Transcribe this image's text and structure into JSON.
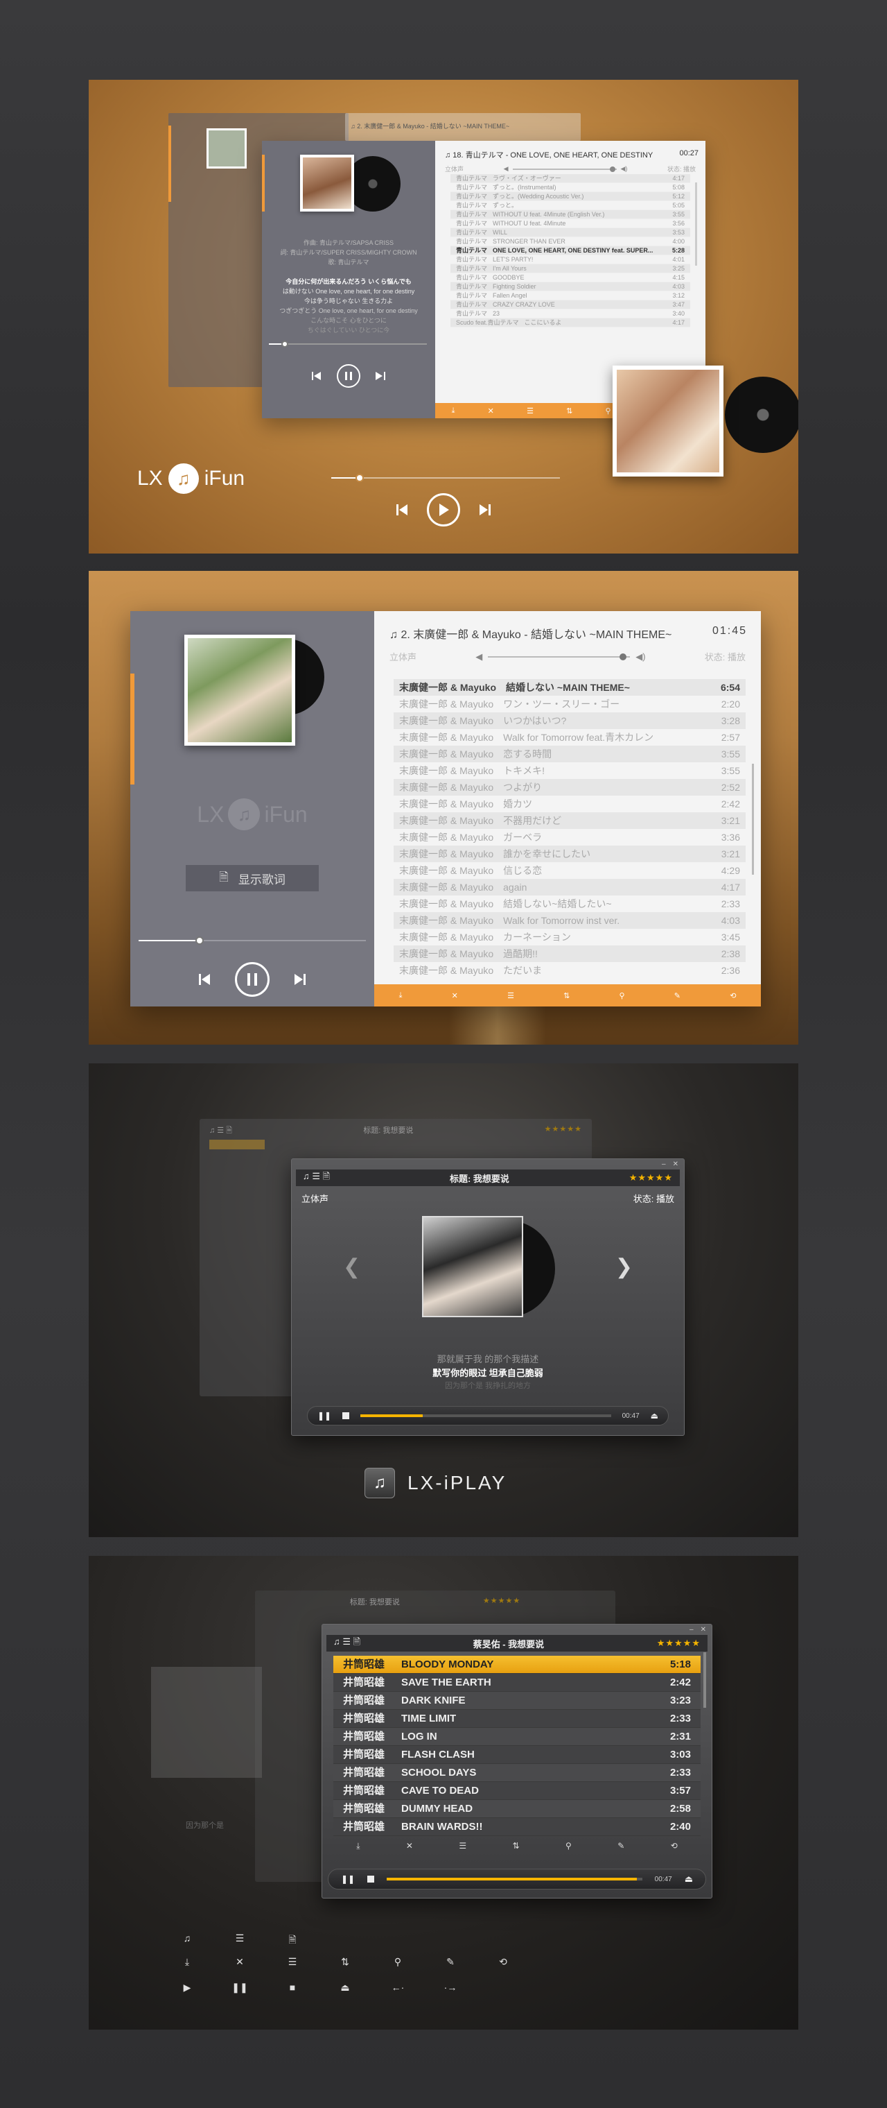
{
  "panel1": {
    "back_title": "♫ 2. 末廣健一郎 & Mayuko - 結婚しない ~MAIN THEME~",
    "now_playing": "♫ 18. 青山テルマ - ONE LOVE, ONE HEART, ONE DESTINY",
    "time": "00:27",
    "stereo": "立体声",
    "status": "状态: 播放",
    "lyrics_meta": [
      "作曲: 青山テルマ/SAPSA CRISS",
      "詞: 青山テルマ/SUPER CRISS/MIGHTY CROWN",
      "歌: 青山テルマ"
    ],
    "lyrics": [
      "今自分に何が出来るんだろう いくら悩んでも",
      "は動けない One love, one heart, for one destiny",
      "今は争う時じゃない 生きる力よ",
      "つぎつぎとう One love, one heart, for one destiny",
      "こんな時こそ 心をひとつに",
      "ちぐはぐしていい ひとつに今"
    ],
    "playlist": [
      {
        "artist": "青山テルマ",
        "title": "ラヴ・イズ・オーヴァー",
        "time": "4:17"
      },
      {
        "artist": "青山テルマ",
        "title": "ずっと。(Instrumental)",
        "time": "5:08"
      },
      {
        "artist": "青山テルマ",
        "title": "ずっと。(Wedding Acoustic Ver.)",
        "time": "5:12"
      },
      {
        "artist": "青山テルマ",
        "title": "ずっと。",
        "time": "5:05"
      },
      {
        "artist": "青山テルマ",
        "title": "WITHOUT U feat. 4Minute (English Ver.)",
        "time": "3:55"
      },
      {
        "artist": "青山テルマ",
        "title": "WITHOUT U feat. 4Minute",
        "time": "3:56"
      },
      {
        "artist": "青山テルマ",
        "title": "WILL",
        "time": "3:53"
      },
      {
        "artist": "青山テルマ",
        "title": "STRONGER THAN EVER",
        "time": "4:00"
      },
      {
        "artist": "青山テルマ",
        "title": "ONE LOVE, ONE HEART, ONE DESTINY feat. SUPER...",
        "time": "5:28"
      },
      {
        "artist": "青山テルマ",
        "title": "LET'S PARTY!",
        "time": "4:01"
      },
      {
        "artist": "青山テルマ",
        "title": "I'm All Yours",
        "time": "3:25"
      },
      {
        "artist": "青山テルマ",
        "title": "GOODBYE",
        "time": "4:15"
      },
      {
        "artist": "青山テルマ",
        "title": "Fighting Soldier",
        "time": "4:03"
      },
      {
        "artist": "青山テルマ",
        "title": "Fallen Angel",
        "time": "3:12"
      },
      {
        "artist": "青山テルマ",
        "title": "CRAZY CRAZY LOVE",
        "time": "3:47"
      },
      {
        "artist": "青山テルマ",
        "title": "23",
        "time": "3:40"
      },
      {
        "artist": "Scudo feat.青山テルマ",
        "title": "ここにいるよ",
        "time": "4:17"
      }
    ],
    "current_index": 8,
    "brand_lx": "LX",
    "brand_name": "iFun",
    "progress": 0.12
  },
  "panel2": {
    "title": "♫ 2. 末廣健一郎 & Mayuko - 結婚しない ~MAIN THEME~",
    "time": "01:45",
    "stereo": "立体声",
    "status": "状态: 播放",
    "brand_lx": "LX",
    "brand_name": "iFun",
    "lyrics_button": "显示歌词",
    "artist": "末廣健一郎 & Mayuko",
    "playlist": [
      {
        "title": "結婚しない ~MAIN THEME~",
        "time": "6:54"
      },
      {
        "title": "ワン・ツー・スリー・ゴー",
        "time": "2:20"
      },
      {
        "title": "いつかはいつ?",
        "time": "3:28"
      },
      {
        "title": "Walk for Tomorrow feat.青木カレン",
        "time": "2:57"
      },
      {
        "title": "恋する時間",
        "time": "3:55"
      },
      {
        "title": "トキメキ!",
        "time": "3:55"
      },
      {
        "title": "つよがり",
        "time": "2:52"
      },
      {
        "title": "婚カツ",
        "time": "2:42"
      },
      {
        "title": "不器用だけど",
        "time": "3:21"
      },
      {
        "title": "ガーベラ",
        "time": "3:36"
      },
      {
        "title": "誰かを幸せにしたい",
        "time": "3:21"
      },
      {
        "title": "信じる恋",
        "time": "4:29"
      },
      {
        "title": "again",
        "time": "4:17"
      },
      {
        "title": "結婚しない~結婚したい~",
        "time": "2:33"
      },
      {
        "title": "Walk for Tomorrow inst ver.",
        "time": "4:03"
      },
      {
        "title": "カーネーション",
        "time": "3:45"
      },
      {
        "title": "過酷期!!",
        "time": "2:38"
      },
      {
        "title": "ただいま",
        "time": "2:36"
      }
    ],
    "progress": 0.27
  },
  "panel3": {
    "title": "标题: 我想要说",
    "stars": "★★★★★",
    "stereo": "立体声",
    "status": "状态: 播放",
    "lyric_prev": "那就属于我 的那个我描述",
    "lyric_current": "默写你的眼过 坦承自己脆弱",
    "lyric_next": "因为那个是 我挣扎的地方",
    "time": "00:47",
    "brand": "LX-iPLAY",
    "progress": 0.25,
    "back_title": "标题: 我想要说"
  },
  "panel4": {
    "title": "蔡旻佑 - 我想要说",
    "stars": "★★★★★",
    "artist": "井筒昭雄",
    "playlist": [
      {
        "title": "BLOODY MONDAY",
        "time": "5:18"
      },
      {
        "title": "SAVE THE EARTH",
        "time": "2:42"
      },
      {
        "title": "DARK KNIFE",
        "time": "3:23"
      },
      {
        "title": "TIME LIMIT",
        "time": "2:33"
      },
      {
        "title": "LOG IN",
        "time": "2:31"
      },
      {
        "title": "FLASH CLASH",
        "time": "3:03"
      },
      {
        "title": "SCHOOL DAYS",
        "time": "2:33"
      },
      {
        "title": "CAVE TO DEAD",
        "time": "3:57"
      },
      {
        "title": "DUMMY HEAD",
        "time": "2:58"
      },
      {
        "title": "BRAIN WARDS!!",
        "time": "2:40"
      }
    ],
    "time": "00:47",
    "progress": 0.98,
    "back_title": "标题: 我想要说",
    "back_lyric": "因为那个是"
  }
}
